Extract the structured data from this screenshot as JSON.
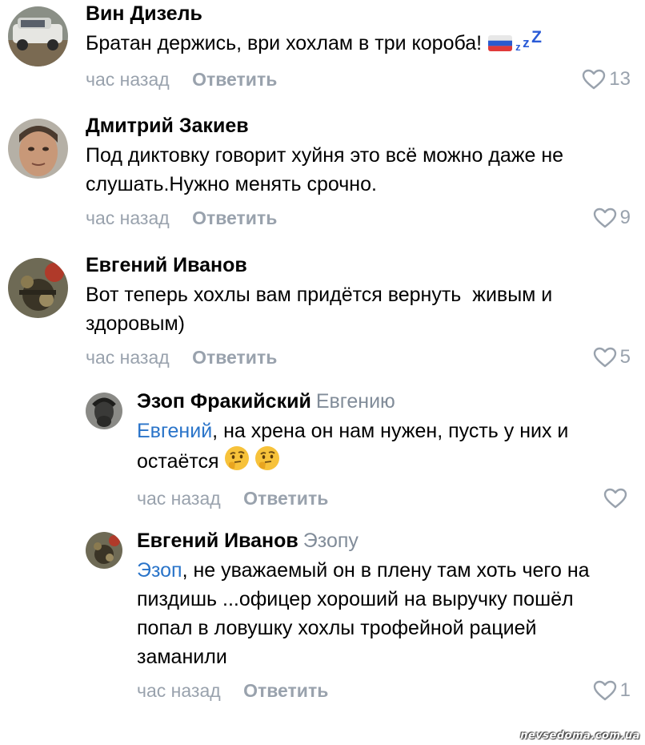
{
  "comments": [
    {
      "author": "Вин Дизель",
      "text": "Братан держись, ври хохлам в три короба!",
      "time": "час назад",
      "reply_label": "Ответить",
      "likes": "13"
    },
    {
      "author": "Дмитрий Закиев",
      "text": "Под диктовку говорит хуйня это всё можно даже не слушать.Нужно менять срочно.",
      "time": "час назад",
      "reply_label": "Ответить",
      "likes": "9"
    },
    {
      "author": "Евгений Иванов",
      "text": "Вот теперь хохлы вам придётся вернуть  живым и здоровым)",
      "time": "час назад",
      "reply_label": "Ответить",
      "likes": "5"
    },
    {
      "author": "Эзоп Фракийский",
      "reply_to": "Евгению",
      "mention": "Евгений",
      "text": ", на хрена он нам нужен, пусть у них и остаётся",
      "time": "час назад",
      "reply_label": "Ответить",
      "likes": ""
    },
    {
      "author": "Евгений Иванов",
      "reply_to": "Эзопу",
      "mention": "Эзоп",
      "text": ", не уважаемый он в плену там хоть чего на пиздишь ...офицер хороший на выручку пошёл попал в ловушку хохлы трофейной рацией заманили",
      "time": "час назад",
      "reply_label": "Ответить",
      "likes": "1"
    }
  ],
  "emoji": {
    "flag": "russia-flag",
    "sleep": "zzz",
    "thinking": "thinking-face"
  },
  "watermark": "nevsedoma.com.ua",
  "colors": {
    "mention": "#2a74c9",
    "meta": "#99a2ad",
    "reply_to": "#818c99"
  }
}
